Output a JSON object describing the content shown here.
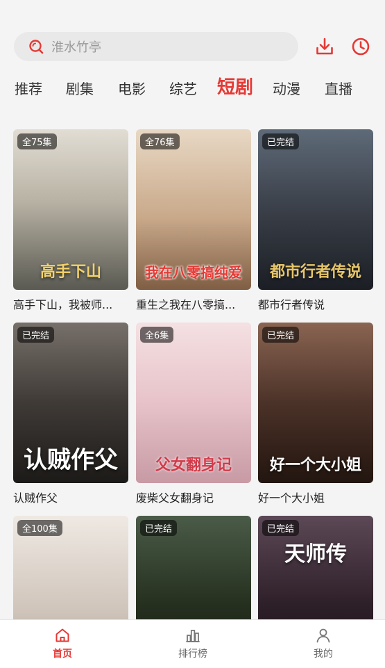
{
  "search": {
    "placeholder": "淮水竹亭"
  },
  "header_icons": {
    "download": "download-icon",
    "history": "history-clock-icon"
  },
  "tabs": [
    {
      "label": "推荐",
      "active": false
    },
    {
      "label": "剧集",
      "active": false
    },
    {
      "label": "电影",
      "active": false
    },
    {
      "label": "综艺",
      "active": false
    },
    {
      "label": "短剧",
      "active": true
    },
    {
      "label": "动漫",
      "active": false
    },
    {
      "label": "直播",
      "active": false
    }
  ],
  "colors": {
    "accent": "#e53935",
    "background": "#f4f4f4"
  },
  "cards": [
    {
      "badge": "全75集",
      "title": "高手下山，我被师...",
      "poster_text": "高手下山",
      "palette": [
        "#d9d3c8",
        "#6b6a5e"
      ]
    },
    {
      "badge": "全76集",
      "title": "重生之我在八零搞...",
      "poster_text": "我在八零搞纯爱",
      "palette": [
        "#d8c0a6",
        "#8a6b52"
      ]
    },
    {
      "badge": "已完结",
      "title": "都市行者传说",
      "poster_text": "都市行者传说",
      "palette": [
        "#4e5866",
        "#1d232b"
      ]
    },
    {
      "badge": "已完结",
      "title": "认贼作父",
      "poster_text": "认贼作父",
      "palette": [
        "#5b5651",
        "#22201e"
      ]
    },
    {
      "badge": "全6集",
      "title": "废柴父女翻身记",
      "poster_text": "父女翻身记",
      "palette": [
        "#f0d4d8",
        "#c99aa3"
      ]
    },
    {
      "badge": "已完结",
      "title": "好一个大小姐",
      "poster_text": "好一个大小姐",
      "palette": [
        "#6a4b3c",
        "#2b1c16"
      ]
    },
    {
      "badge": "全100集",
      "title": "",
      "poster_text": "",
      "palette": [
        "#e8e2dc",
        "#b9aca2"
      ]
    },
    {
      "badge": "已完结",
      "title": "",
      "poster_text": "",
      "palette": [
        "#3c4a3a",
        "#151a14"
      ]
    },
    {
      "badge": "已完结",
      "title": "",
      "poster_text": "天师传",
      "palette": [
        "#4a3a44",
        "#170f14"
      ]
    }
  ],
  "bottom_nav": [
    {
      "label": "首页",
      "icon": "home-icon",
      "active": true
    },
    {
      "label": "排行榜",
      "icon": "ranking-icon",
      "active": false
    },
    {
      "label": "我的",
      "icon": "profile-icon",
      "active": false
    }
  ]
}
